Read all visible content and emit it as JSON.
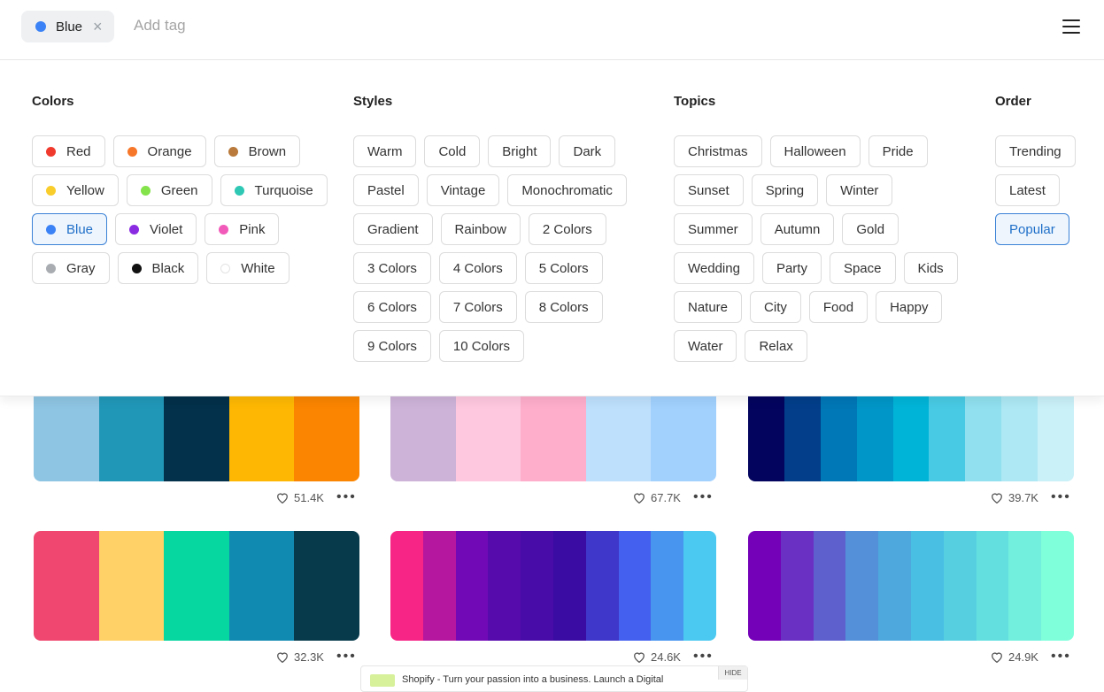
{
  "search": {
    "active_tag": "Blue",
    "active_tag_color": "#3b82f6",
    "placeholder": "Add tag",
    "remove_icon": "close-icon"
  },
  "menu": {
    "icon": "hamburger-menu-icon"
  },
  "filters": {
    "colors": {
      "title": "Colors",
      "items": [
        {
          "label": "Red",
          "color": "#f03a2e"
        },
        {
          "label": "Orange",
          "color": "#f7772a"
        },
        {
          "label": "Brown",
          "color": "#b97a3b"
        },
        {
          "label": "Yellow",
          "color": "#f9cd2b"
        },
        {
          "label": "Green",
          "color": "#84e34b"
        },
        {
          "label": "Turquoise",
          "color": "#2ec8b5"
        },
        {
          "label": "Blue",
          "color": "#3b82f6",
          "selected": true
        },
        {
          "label": "Violet",
          "color": "#8a2be2"
        },
        {
          "label": "Pink",
          "color": "#f25ab9"
        },
        {
          "label": "Gray",
          "color": "#a9adb2"
        },
        {
          "label": "Black",
          "color": "#111111"
        },
        {
          "label": "White",
          "color": "#ffffff"
        }
      ]
    },
    "styles": {
      "title": "Styles",
      "items": [
        "Warm",
        "Cold",
        "Bright",
        "Dark",
        "Pastel",
        "Vintage",
        "Monochromatic",
        "Gradient",
        "Rainbow",
        "2 Colors",
        "3 Colors",
        "4 Colors",
        "5 Colors",
        "6 Colors",
        "7 Colors",
        "8 Colors",
        "9 Colors",
        "10 Colors"
      ]
    },
    "topics": {
      "title": "Topics",
      "items": [
        "Christmas",
        "Halloween",
        "Pride",
        "Sunset",
        "Spring",
        "Winter",
        "Summer",
        "Autumn",
        "Gold",
        "Wedding",
        "Party",
        "Space",
        "Kids",
        "Nature",
        "City",
        "Food",
        "Happy",
        "Water",
        "Relax"
      ]
    },
    "order": {
      "title": "Order",
      "items": [
        {
          "label": "Trending"
        },
        {
          "label": "Latest"
        },
        {
          "label": "Popular",
          "selected": true
        }
      ]
    }
  },
  "palettes": [
    {
      "colors": [
        "#8ec5e2",
        "#2197b8",
        "#03304a",
        "#feb803",
        "#fb8500"
      ],
      "likes": "51.4K"
    },
    {
      "colors": [
        "#cdb3d8",
        "#fec8df",
        "#feaecb",
        "#bee0fd",
        "#a2d1fe"
      ],
      "likes": "67.7K"
    },
    {
      "colors": [
        "#03045e",
        "#023e8a",
        "#0077b6",
        "#0096c7",
        "#00b4d8",
        "#48cae4",
        "#90e0ef",
        "#ade8f4",
        "#caf0f8"
      ],
      "likes": "39.7K"
    },
    {
      "colors": [
        "#ef476f",
        "#ffd166",
        "#06d6a0",
        "#118ab2",
        "#073b4c"
      ],
      "likes": "32.3K"
    },
    {
      "colors": [
        "#f72585",
        "#b5179e",
        "#7209b7",
        "#560bad",
        "#480ca8",
        "#3a0ca3",
        "#3f37c9",
        "#4361ee",
        "#4895ef",
        "#4cc9f0"
      ],
      "likes": "24.6K"
    },
    {
      "colors": [
        "#7400b8",
        "#6930c3",
        "#5e60ce",
        "#5390d9",
        "#4ea8de",
        "#48bfe3",
        "#56cfe1",
        "#64dfdf",
        "#72efdd",
        "#80ffdb"
      ],
      "likes": "24.9K"
    }
  ],
  "ad": {
    "text": "Shopify - Turn your passion into a business. Launch a Digital",
    "hide_label": "HIDE"
  }
}
